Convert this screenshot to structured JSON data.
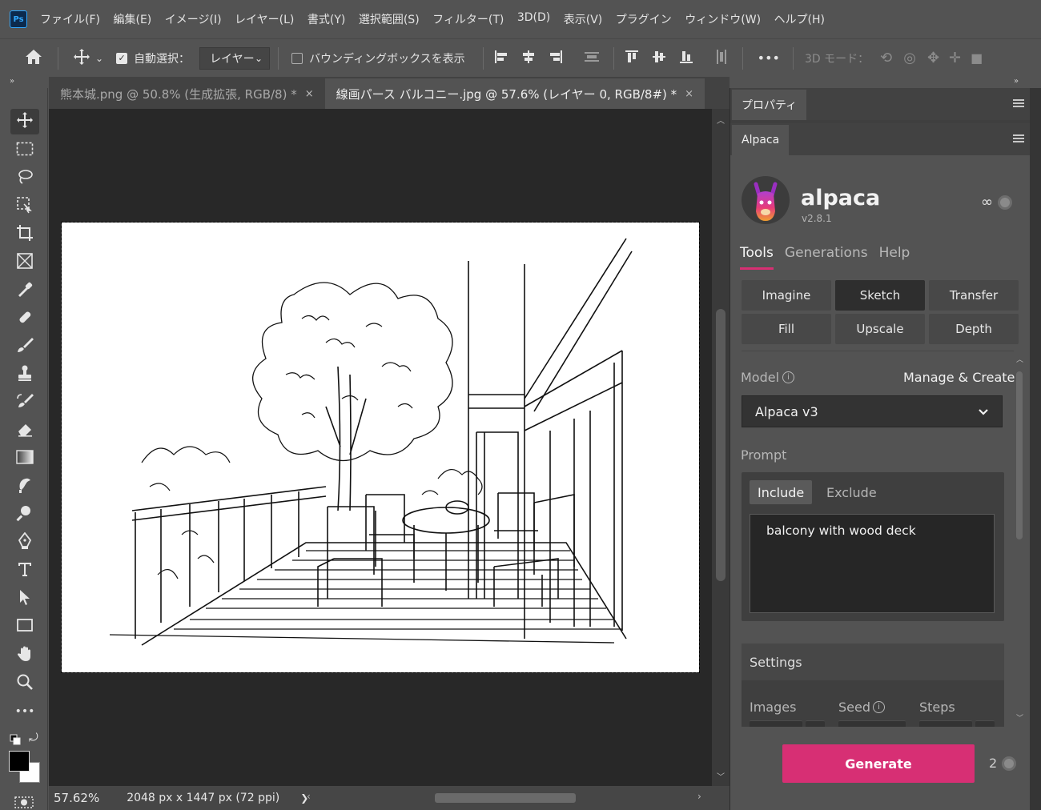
{
  "app": {
    "logo": "Ps"
  },
  "menu": [
    "ファイル(F)",
    "編集(E)",
    "イメージ(I)",
    "レイヤー(L)",
    "書式(Y)",
    "選択範囲(S)",
    "フィルター(T)",
    "3D(D)",
    "表示(V)",
    "プラグイン",
    "ウィンドウ(W)",
    "ヘルプ(H)"
  ],
  "options": {
    "auto_select_label": "自動選択：",
    "auto_select_checked": true,
    "target_value": "レイヤー",
    "bounding_box_label": "バウンディングボックスを表示",
    "bounding_box_checked": false,
    "more": "•••",
    "mode_3d_label": "3D モード："
  },
  "tabs": [
    {
      "label": "熊本城.png @ 50.8% (生成拡張, RGB/8) *",
      "active": false,
      "close": "×"
    },
    {
      "label": "線画パース バルコニー.jpg @ 57.6% (レイヤー 0, RGB/8#) *",
      "active": true,
      "close": "×"
    }
  ],
  "status": {
    "zoom": "57.62%",
    "doc_info": "2048 px x 1447 px (72 ppi)",
    "arrow": "❯"
  },
  "properties_panel": {
    "tab": "プロパティ"
  },
  "alpaca_panel": {
    "tab": "Alpaca",
    "brand": "alpaca",
    "version": "v2.8.1",
    "credits": "∞",
    "main_tabs": [
      {
        "label": "Tools",
        "active": true
      },
      {
        "label": "Generations",
        "active": false
      },
      {
        "label": "Help",
        "active": false
      }
    ],
    "tools": [
      {
        "label": "Imagine",
        "active": false
      },
      {
        "label": "Sketch",
        "active": true
      },
      {
        "label": "Transfer",
        "active": false
      },
      {
        "label": "Fill",
        "active": false
      },
      {
        "label": "Upscale",
        "active": false
      },
      {
        "label": "Depth",
        "active": false
      }
    ],
    "model_label": "Model",
    "manage_link": "Manage & Create",
    "model_value": "Alpaca v3",
    "prompt_label": "Prompt",
    "prompt_tabs": [
      {
        "label": "Include",
        "active": true
      },
      {
        "label": "Exclude",
        "active": false
      }
    ],
    "prompt_text": "balcony with wood deck",
    "settings_label": "Settings",
    "settings_fields": [
      "Images",
      "Seed",
      "Steps"
    ],
    "generate_label": "Generate",
    "generate_count": "2"
  },
  "colors": {
    "accent": "#d72f74",
    "chrome": "#535353",
    "canvas_bg": "#282828"
  }
}
